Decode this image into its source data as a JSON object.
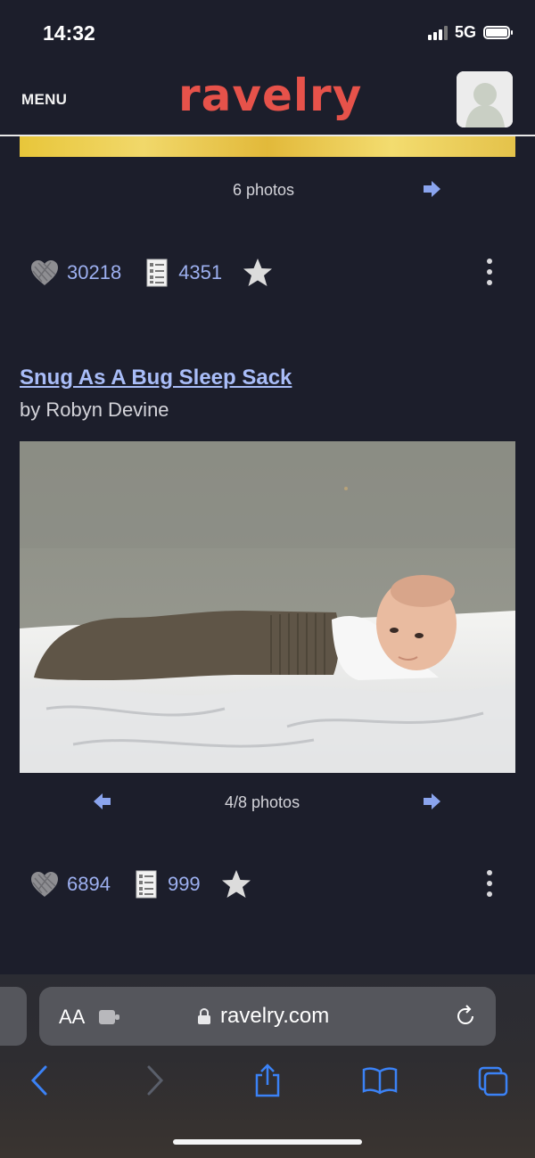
{
  "status_bar": {
    "time": "14:32",
    "network": "5G"
  },
  "header": {
    "menu_label": "MENU",
    "logo_text": "ravelry"
  },
  "patterns": [
    {
      "photo_count": "6 photos",
      "favorites": "30218",
      "projects": "4351"
    },
    {
      "title": "Snug As A Bug Sleep Sack",
      "author": "by Robyn Devine",
      "photo_count": "4/8 photos",
      "favorites": "6894",
      "projects": "999"
    }
  ],
  "browser": {
    "aa_label": "AA",
    "url": "ravelry.com"
  },
  "icons": {
    "favorite": "yarn-heart-icon",
    "projects": "project-list-icon",
    "queue": "star-icon",
    "more": "kebab-menu-icon"
  },
  "colors": {
    "background": "#1c1e2b",
    "brand": "#e6524a",
    "link": "#a9bdf8",
    "accent": "#8aa4ee",
    "safari_blue": "#3b82f6"
  }
}
